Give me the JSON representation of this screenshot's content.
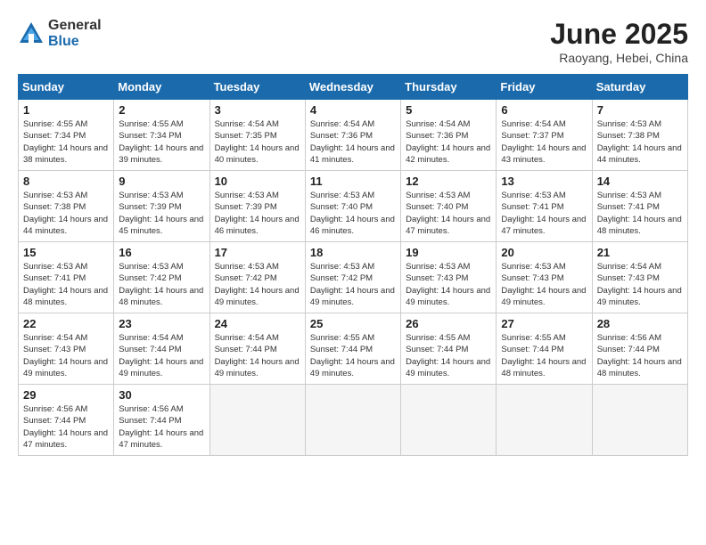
{
  "header": {
    "logo_general": "General",
    "logo_blue": "Blue",
    "month_title": "June 2025",
    "location": "Raoyang, Hebei, China"
  },
  "weekdays": [
    "Sunday",
    "Monday",
    "Tuesday",
    "Wednesday",
    "Thursday",
    "Friday",
    "Saturday"
  ],
  "weeks": [
    [
      {
        "day": 1,
        "sunrise": "4:55 AM",
        "sunset": "7:34 PM",
        "daylight": "14 hours and 38 minutes."
      },
      {
        "day": 2,
        "sunrise": "4:55 AM",
        "sunset": "7:34 PM",
        "daylight": "14 hours and 39 minutes."
      },
      {
        "day": 3,
        "sunrise": "4:54 AM",
        "sunset": "7:35 PM",
        "daylight": "14 hours and 40 minutes."
      },
      {
        "day": 4,
        "sunrise": "4:54 AM",
        "sunset": "7:36 PM",
        "daylight": "14 hours and 41 minutes."
      },
      {
        "day": 5,
        "sunrise": "4:54 AM",
        "sunset": "7:36 PM",
        "daylight": "14 hours and 42 minutes."
      },
      {
        "day": 6,
        "sunrise": "4:54 AM",
        "sunset": "7:37 PM",
        "daylight": "14 hours and 43 minutes."
      },
      {
        "day": 7,
        "sunrise": "4:53 AM",
        "sunset": "7:38 PM",
        "daylight": "14 hours and 44 minutes."
      }
    ],
    [
      {
        "day": 8,
        "sunrise": "4:53 AM",
        "sunset": "7:38 PM",
        "daylight": "14 hours and 44 minutes."
      },
      {
        "day": 9,
        "sunrise": "4:53 AM",
        "sunset": "7:39 PM",
        "daylight": "14 hours and 45 minutes."
      },
      {
        "day": 10,
        "sunrise": "4:53 AM",
        "sunset": "7:39 PM",
        "daylight": "14 hours and 46 minutes."
      },
      {
        "day": 11,
        "sunrise": "4:53 AM",
        "sunset": "7:40 PM",
        "daylight": "14 hours and 46 minutes."
      },
      {
        "day": 12,
        "sunrise": "4:53 AM",
        "sunset": "7:40 PM",
        "daylight": "14 hours and 47 minutes."
      },
      {
        "day": 13,
        "sunrise": "4:53 AM",
        "sunset": "7:41 PM",
        "daylight": "14 hours and 47 minutes."
      },
      {
        "day": 14,
        "sunrise": "4:53 AM",
        "sunset": "7:41 PM",
        "daylight": "14 hours and 48 minutes."
      }
    ],
    [
      {
        "day": 15,
        "sunrise": "4:53 AM",
        "sunset": "7:41 PM",
        "daylight": "14 hours and 48 minutes."
      },
      {
        "day": 16,
        "sunrise": "4:53 AM",
        "sunset": "7:42 PM",
        "daylight": "14 hours and 48 minutes."
      },
      {
        "day": 17,
        "sunrise": "4:53 AM",
        "sunset": "7:42 PM",
        "daylight": "14 hours and 49 minutes."
      },
      {
        "day": 18,
        "sunrise": "4:53 AM",
        "sunset": "7:42 PM",
        "daylight": "14 hours and 49 minutes."
      },
      {
        "day": 19,
        "sunrise": "4:53 AM",
        "sunset": "7:43 PM",
        "daylight": "14 hours and 49 minutes."
      },
      {
        "day": 20,
        "sunrise": "4:53 AM",
        "sunset": "7:43 PM",
        "daylight": "14 hours and 49 minutes."
      },
      {
        "day": 21,
        "sunrise": "4:54 AM",
        "sunset": "7:43 PM",
        "daylight": "14 hours and 49 minutes."
      }
    ],
    [
      {
        "day": 22,
        "sunrise": "4:54 AM",
        "sunset": "7:43 PM",
        "daylight": "14 hours and 49 minutes."
      },
      {
        "day": 23,
        "sunrise": "4:54 AM",
        "sunset": "7:44 PM",
        "daylight": "14 hours and 49 minutes."
      },
      {
        "day": 24,
        "sunrise": "4:54 AM",
        "sunset": "7:44 PM",
        "daylight": "14 hours and 49 minutes."
      },
      {
        "day": 25,
        "sunrise": "4:55 AM",
        "sunset": "7:44 PM",
        "daylight": "14 hours and 49 minutes."
      },
      {
        "day": 26,
        "sunrise": "4:55 AM",
        "sunset": "7:44 PM",
        "daylight": "14 hours and 49 minutes."
      },
      {
        "day": 27,
        "sunrise": "4:55 AM",
        "sunset": "7:44 PM",
        "daylight": "14 hours and 48 minutes."
      },
      {
        "day": 28,
        "sunrise": "4:56 AM",
        "sunset": "7:44 PM",
        "daylight": "14 hours and 48 minutes."
      }
    ],
    [
      {
        "day": 29,
        "sunrise": "4:56 AM",
        "sunset": "7:44 PM",
        "daylight": "14 hours and 47 minutes."
      },
      {
        "day": 30,
        "sunrise": "4:56 AM",
        "sunset": "7:44 PM",
        "daylight": "14 hours and 47 minutes."
      },
      null,
      null,
      null,
      null,
      null
    ]
  ]
}
